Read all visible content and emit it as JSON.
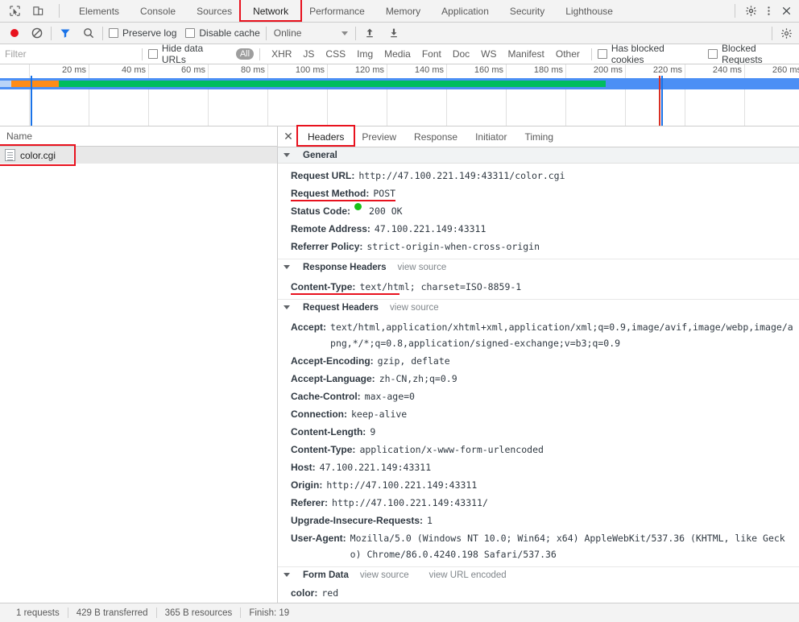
{
  "toolbar": {
    "inspect_icon": "inspect-cursor-icon",
    "device_icon": "device-toggle-icon",
    "tabs": [
      {
        "label": "Elements",
        "active": false
      },
      {
        "label": "Console",
        "active": false
      },
      {
        "label": "Sources",
        "active": false
      },
      {
        "label": "Network",
        "active": true
      },
      {
        "label": "Performance",
        "active": false
      },
      {
        "label": "Memory",
        "active": false
      },
      {
        "label": "Application",
        "active": false
      },
      {
        "label": "Security",
        "active": false
      },
      {
        "label": "Lighthouse",
        "active": false
      }
    ],
    "settings_icon": "gear-icon",
    "more_icon": "kebab-menu-icon",
    "close_icon": "close-icon"
  },
  "network_toolbar": {
    "record_icon": "record-circle-icon",
    "clear_icon": "clear-prohibited-icon",
    "filter_icon": "funnel-filter-icon",
    "search_icon": "search-icon",
    "preserve_log": "Preserve log",
    "disable_cache": "Disable cache",
    "throttling": "Online",
    "import_icon": "import-up-arrow-icon",
    "export_icon": "export-down-arrow-icon",
    "settings_icon": "gear-icon"
  },
  "filter_bar": {
    "placeholder": "Filter",
    "value": "",
    "hide_data_urls": "Hide data URLs",
    "types": [
      "All",
      "XHR",
      "JS",
      "CSS",
      "Img",
      "Media",
      "Font",
      "Doc",
      "WS",
      "Manifest",
      "Other"
    ],
    "selected_type": "All",
    "has_blocked_cookies": "Has blocked cookies",
    "blocked_requests": "Blocked Requests"
  },
  "overview": {
    "ticks": [
      "20 ms",
      "40 ms",
      "60 ms",
      "80 ms",
      "100 ms",
      "120 ms",
      "140 ms",
      "160 ms",
      "180 ms",
      "200 ms",
      "220 ms",
      "240 ms",
      "260 ms"
    ],
    "colors": {
      "queue": "#b8d3f7",
      "waiting": "#ff8c17",
      "download": "#00bd5f",
      "band": "#4b8ff5",
      "dom_content_loaded": "#1a73e8",
      "load": "#d93025"
    }
  },
  "request_list": {
    "column_name": "Name",
    "rows": [
      {
        "name": "color.cgi",
        "icon": "document-icon",
        "selected": true,
        "annotated": true
      }
    ]
  },
  "details": {
    "close_icon": "close-icon",
    "tabs": [
      {
        "label": "Headers",
        "active": true
      },
      {
        "label": "Preview",
        "active": false
      },
      {
        "label": "Response",
        "active": false
      },
      {
        "label": "Initiator",
        "active": false
      },
      {
        "label": "Timing",
        "active": false
      }
    ],
    "general": {
      "title": "General",
      "items": [
        {
          "name": "Request URL:",
          "value": "http://47.100.221.149:43311/color.cgi"
        },
        {
          "name": "Request Method:",
          "value": "POST",
          "annotated": true
        },
        {
          "name": "Status Code:",
          "value": "200 OK",
          "dot": true
        },
        {
          "name": "Remote Address:",
          "value": "47.100.221.149:43311"
        },
        {
          "name": "Referrer Policy:",
          "value": "strict-origin-when-cross-origin"
        }
      ]
    },
    "response_headers": {
      "title": "Response Headers",
      "view_source": "view source",
      "items": [
        {
          "name": "Content-Type:",
          "value": "text/html; charset=ISO-8859-1",
          "annotated": true
        }
      ]
    },
    "request_headers": {
      "title": "Request Headers",
      "view_source": "view source",
      "items": [
        {
          "name": "Accept:",
          "value": "text/html,application/xhtml+xml,application/xml;q=0.9,image/avif,image/webp,image/apng,*/*;q=0.8,application/signed-exchange;v=b3;q=0.9"
        },
        {
          "name": "Accept-Encoding:",
          "value": "gzip, deflate"
        },
        {
          "name": "Accept-Language:",
          "value": "zh-CN,zh;q=0.9"
        },
        {
          "name": "Cache-Control:",
          "value": "max-age=0"
        },
        {
          "name": "Connection:",
          "value": "keep-alive"
        },
        {
          "name": "Content-Length:",
          "value": "9"
        },
        {
          "name": "Content-Type:",
          "value": "application/x-www-form-urlencoded"
        },
        {
          "name": "Host:",
          "value": "47.100.221.149:43311"
        },
        {
          "name": "Origin:",
          "value": "http://47.100.221.149:43311"
        },
        {
          "name": "Referer:",
          "value": "http://47.100.221.149:43311/"
        },
        {
          "name": "Upgrade-Insecure-Requests:",
          "value": "1"
        },
        {
          "name": "User-Agent:",
          "value": "Mozilla/5.0 (Windows NT 10.0; Win64; x64) AppleWebKit/537.36 (KHTML, like Gecko) Chrome/86.0.4240.198 Safari/537.36"
        }
      ]
    },
    "form_data": {
      "title": "Form Data",
      "view_source": "view source",
      "view_url_encoded": "view URL encoded",
      "items": [
        {
          "name": "color:",
          "value": "red"
        }
      ]
    }
  },
  "status_bar": {
    "requests": "1 requests",
    "transferred": "429 B transferred",
    "resources": "365 B resources",
    "finish": "Finish: 19"
  }
}
